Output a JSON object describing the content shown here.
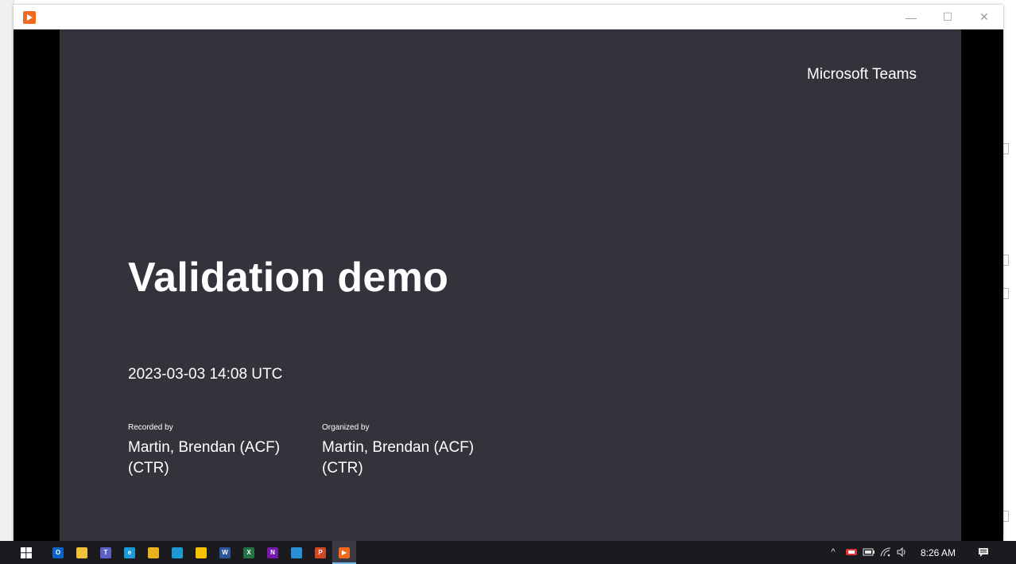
{
  "window": {
    "minimize_glyph": "—",
    "maximize_glyph": "☐",
    "close_glyph": "✕"
  },
  "slide": {
    "brand": "Microsoft Teams",
    "title": "Validation demo",
    "date": "2023-03-03 14:08 UTC",
    "recorded_by_label": "Recorded by",
    "recorded_by_value": "Martin, Brendan (ACF) (CTR)",
    "organized_by_label": "Organized by",
    "organized_by_value": "Martin, Brendan (ACF) (CTR)"
  },
  "taskbar": {
    "apps": [
      {
        "name": "outlook-icon",
        "color": "#0a64c8",
        "glyph": "O"
      },
      {
        "name": "file-explorer-icon",
        "color": "#f0c23a",
        "glyph": ""
      },
      {
        "name": "teams-icon",
        "color": "#5b5fc7",
        "glyph": "T"
      },
      {
        "name": "edge-icon",
        "color": "#1a9bd7",
        "glyph": "e"
      },
      {
        "name": "chrome-icon",
        "color": "#e8b31c",
        "glyph": ""
      },
      {
        "name": "skype-icon",
        "color": "#1d9ad6",
        "glyph": ""
      },
      {
        "name": "sticky-notes-icon",
        "color": "#f7c200",
        "glyph": ""
      },
      {
        "name": "word-icon",
        "color": "#2b579a",
        "glyph": "W"
      },
      {
        "name": "excel-icon",
        "color": "#217346",
        "glyph": "X"
      },
      {
        "name": "onenote-icon",
        "color": "#7719aa",
        "glyph": "N"
      },
      {
        "name": "chat-app-icon",
        "color": "#2a8fd6",
        "glyph": ""
      },
      {
        "name": "powerpoint-icon",
        "color": "#d24726",
        "glyph": "P"
      },
      {
        "name": "media-player-icon",
        "color": "#f26a1b",
        "glyph": "▶"
      }
    ],
    "clock": "8:26 AM",
    "tray_chevron": "^"
  }
}
